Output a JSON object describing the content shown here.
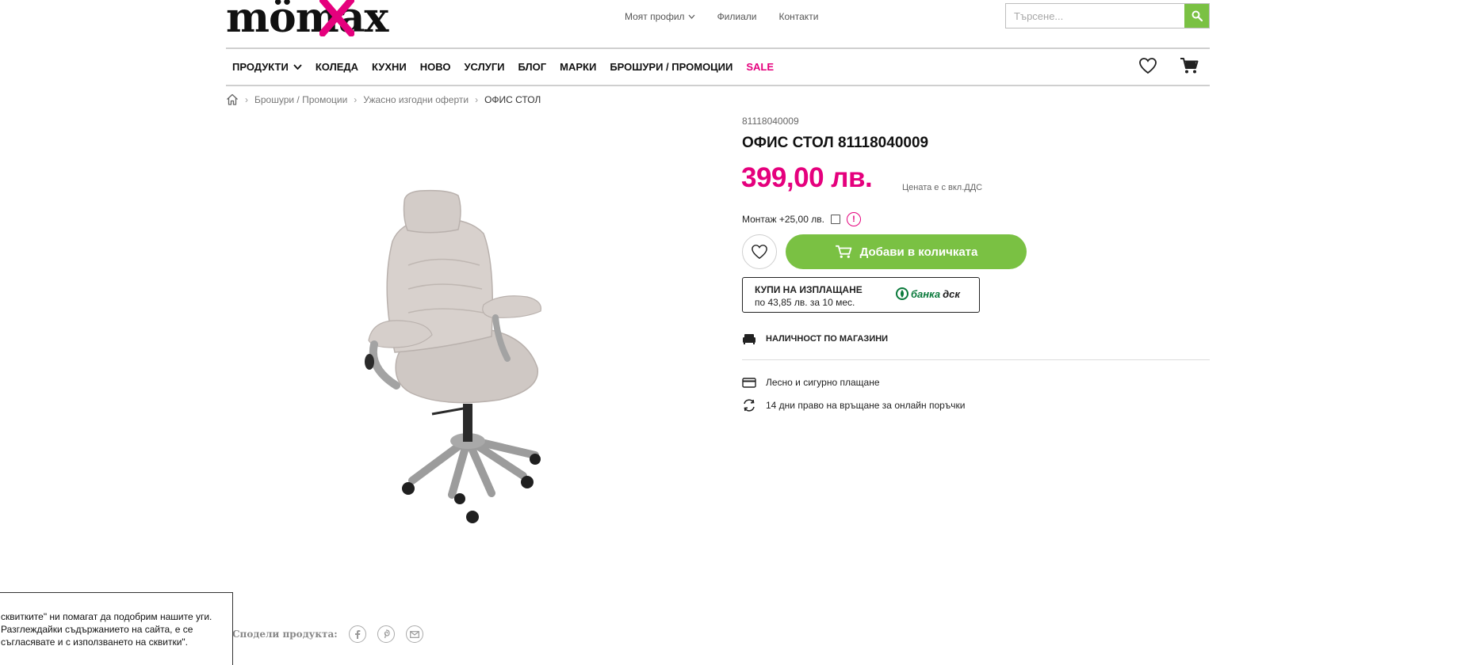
{
  "brand": {
    "logo_text": "mömax",
    "accent_color": "#e5007d",
    "green_color": "#7ac143"
  },
  "top_links": {
    "profile": "Моят профил",
    "stores": "Филиали",
    "contacts": "Контакти"
  },
  "search": {
    "placeholder": "Търсене...",
    "icon": "search-icon"
  },
  "nav": {
    "products": "ПРОДУКТИ",
    "christmas": "КОЛЕДА",
    "kitchens": "КУХНИ",
    "new": "НОВО",
    "services": "УСЛУГИ",
    "blog": "БЛОГ",
    "brands": "МАРКИ",
    "brochures": "БРОШУРИ / ПРОМОЦИИ",
    "sale": "SALE"
  },
  "breadcrumb": {
    "items": [
      "Брошури / Промоции",
      "Ужасно изгодни оферти"
    ],
    "current": "ОФИС СТОЛ"
  },
  "product": {
    "sku": "81118040009",
    "title": "ОФИС СТОЛ 81118040009",
    "price": "399,00 лв.",
    "vat_note": "Цената е с вкл.ДДС",
    "montage_label": "Монтаж +25,00 лв.",
    "montage_checked": false,
    "info_glyph": "!",
    "add_to_cart": "Добави в количката"
  },
  "installment": {
    "title": "КУПИ НА ИЗПЛАЩАНЕ",
    "subtitle": "по 43,85 лв. за 10 мес.",
    "bank_prefix": "банка",
    "bank_name": "дск"
  },
  "stock_label": "НАЛИЧНОСТ ПО МАГАЗИНИ",
  "features": [
    {
      "icon": "credit-card-icon",
      "text": "Лесно и сигурно плащане"
    },
    {
      "icon": "return-arrows-icon",
      "text": "14 дни право на връщане за онлайн поръчки"
    }
  ],
  "share_label": "Сподели продукта:",
  "cookie_text": "сквитките\" ни помагат да подобрим нашите уги. Разглеждайки съдържанието на сайта, е се съгласявате и с използването на сквитки\"."
}
